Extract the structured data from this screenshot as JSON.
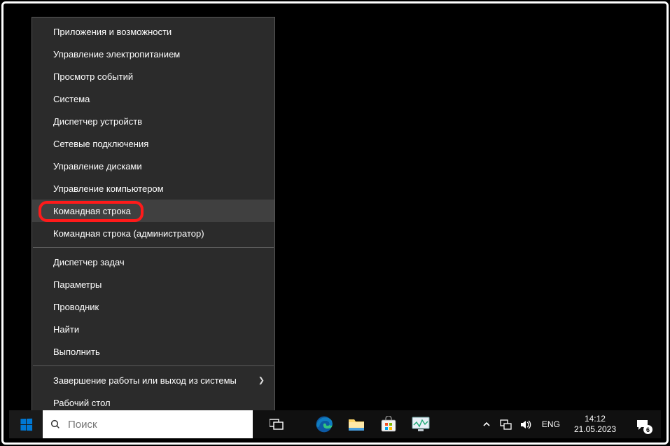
{
  "menu": {
    "items": [
      {
        "label": "Приложения и возможности",
        "hovered": false
      },
      {
        "label": "Управление электропитанием",
        "hovered": false
      },
      {
        "label": "Просмотр событий",
        "hovered": false
      },
      {
        "label": "Система",
        "hovered": false
      },
      {
        "label": "Диспетчер устройств",
        "hovered": false
      },
      {
        "label": "Сетевые подключения",
        "hovered": false
      },
      {
        "label": "Управление дисками",
        "hovered": false
      },
      {
        "label": "Управление компьютером",
        "hovered": false
      },
      {
        "label": "Командная строка",
        "hovered": true,
        "highlight": true
      },
      {
        "label": "Командная строка (администратор)",
        "hovered": false
      }
    ],
    "items2": [
      {
        "label": "Диспетчер задач",
        "hovered": false
      },
      {
        "label": "Параметры",
        "hovered": false
      },
      {
        "label": "Проводник",
        "hovered": false
      },
      {
        "label": "Найти",
        "hovered": false
      },
      {
        "label": "Выполнить",
        "hovered": false
      }
    ],
    "items3": [
      {
        "label": "Завершение работы или выход из системы",
        "submenu": true
      },
      {
        "label": "Рабочий стол"
      }
    ]
  },
  "taskbar": {
    "search_placeholder": "Поиск",
    "lang": "ENG",
    "time": "14:12",
    "date": "21.05.2023",
    "notif_count": "6"
  }
}
